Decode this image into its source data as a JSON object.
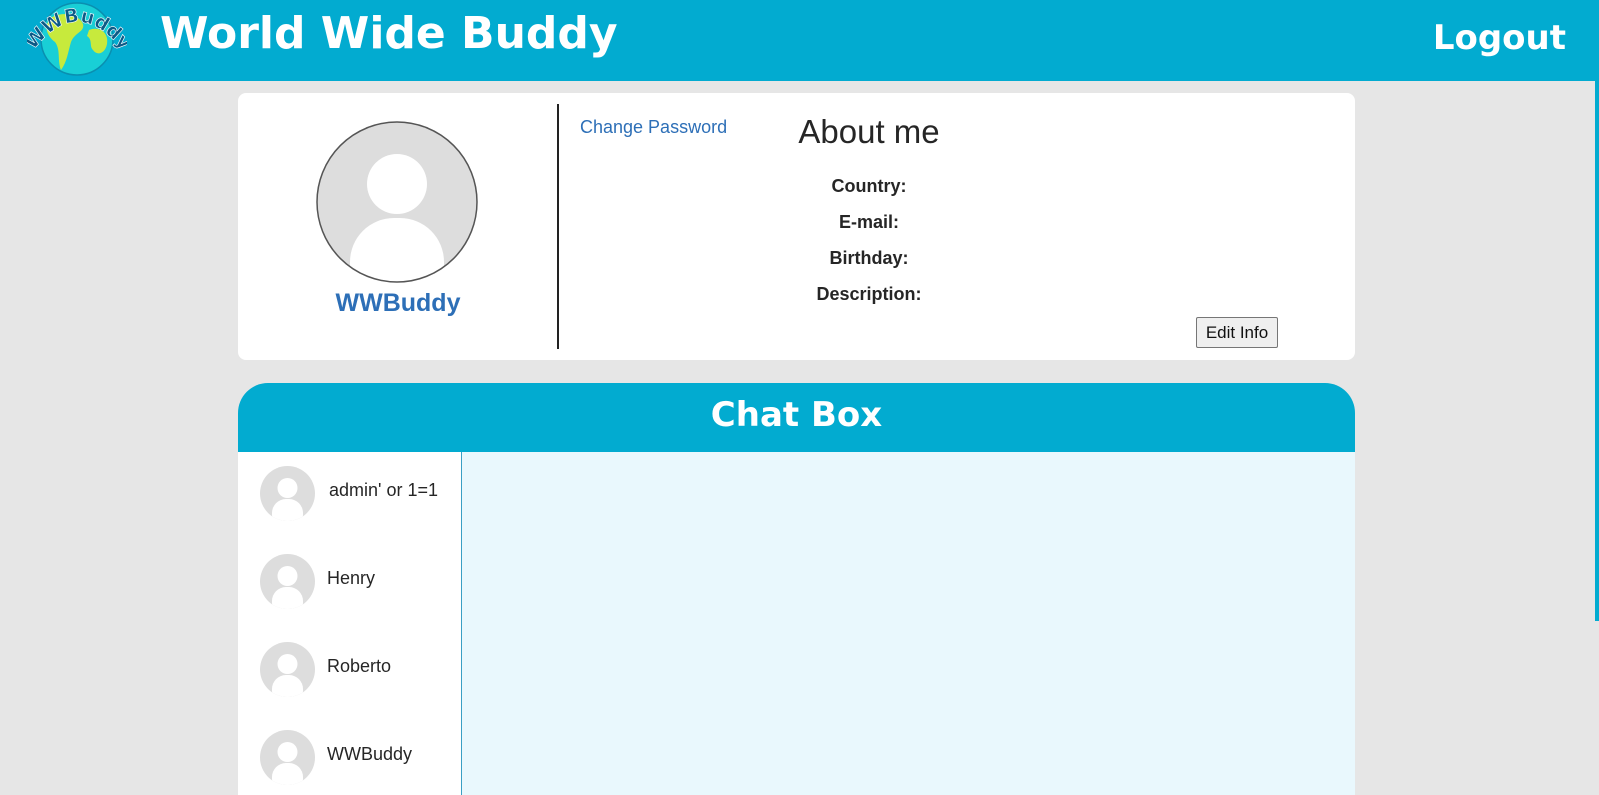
{
  "header": {
    "logo_text": "WWBuddy",
    "title": "World Wide Buddy",
    "logout_label": "Logout"
  },
  "profile": {
    "username": "WWBuddy",
    "change_password_label": "Change Password",
    "about_title": "About me",
    "fields": {
      "country_label": "Country:",
      "email_label": "E-mail:",
      "birthday_label": "Birthday:",
      "description_label": "Description:"
    },
    "edit_button_label": "Edit Info"
  },
  "chat": {
    "title": "Chat Box",
    "contacts": [
      {
        "name": "admin' or 1=1"
      },
      {
        "name": "Henry"
      },
      {
        "name": "Roberto"
      },
      {
        "name": "WWBuddy"
      }
    ]
  },
  "colors": {
    "brand": "#02abd0",
    "link": "#2d6fb7",
    "chat_background": "#e9f8fd",
    "page_background": "#e6e6e6"
  },
  "icons": {
    "logo": "globe-logo-icon",
    "avatar": "user-avatar-icon"
  }
}
